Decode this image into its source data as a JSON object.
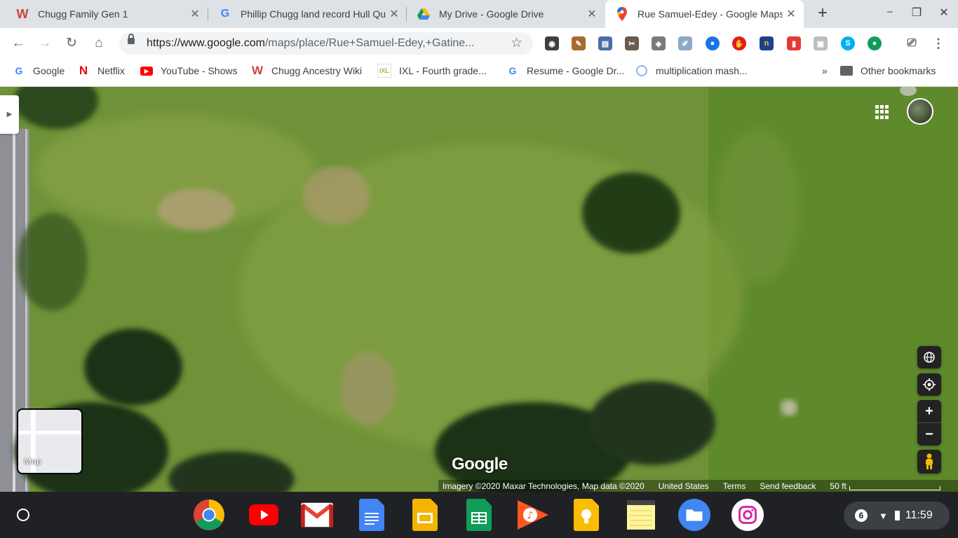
{
  "tabs": [
    {
      "title": "Chugg Family Gen 1",
      "icon": "wikitree-icon"
    },
    {
      "title": "Phillip Chugg land record Hull Qu",
      "icon": "google-icon"
    },
    {
      "title": "My Drive - Google Drive",
      "icon": "google-drive-icon"
    },
    {
      "title": "Rue Samuel-Edey - Google Maps",
      "icon": "google-maps-icon",
      "active": true
    }
  ],
  "toolbar": {
    "url_host": "https://www.google.com",
    "url_path": "/maps/place/Rue+Samuel-Edey,+Gatine..."
  },
  "bookmarks": [
    {
      "label": "Google",
      "icon": "google-icon"
    },
    {
      "label": "Netflix",
      "icon": "netflix-icon"
    },
    {
      "label": "YouTube - Shows",
      "icon": "youtube-icon"
    },
    {
      "label": "Chugg Ancestry Wiki",
      "icon": "wikitree-icon"
    },
    {
      "label": "IXL - Fourth grade...",
      "icon": "ixl-icon"
    },
    {
      "label": "Resume - Google Dr...",
      "icon": "google-icon"
    },
    {
      "label": "multiplication mash...",
      "icon": "globe-icon"
    }
  ],
  "bookmarks_more": "»",
  "other_bookmarks": "Other bookmarks",
  "map": {
    "minimap_label": "Map",
    "watermark": "Google",
    "attribution": "Imagery ©2020 Maxar Technologies, Map data ©2020",
    "region": "United States",
    "terms": "Terms",
    "feedback": "Send feedback",
    "scale": "50 ft"
  },
  "tray": {
    "notifications": "6",
    "time": "11:59"
  },
  "colors": {
    "tabstrip": "#dee1e6",
    "shelf": "#202124",
    "grass": "#6d9137"
  }
}
